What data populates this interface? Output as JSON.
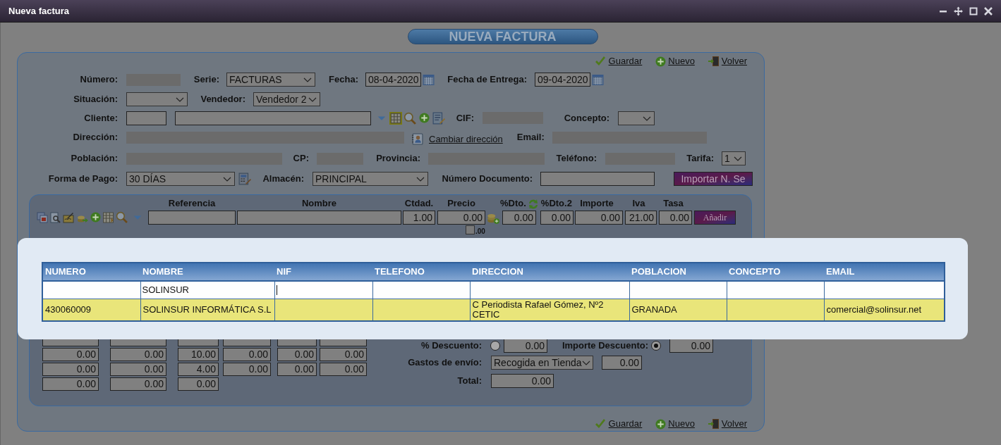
{
  "window": {
    "title": "Nueva factura"
  },
  "heading": "NUEVA FACTURA",
  "top_actions": [
    {
      "label": "Guardar"
    },
    {
      "label": "Nuevo"
    },
    {
      "label": "Volver"
    }
  ],
  "form": {
    "numero": {
      "label": "Número:"
    },
    "serie": {
      "label": "Serie:",
      "value": "FACTURAS"
    },
    "fecha": {
      "label": "Fecha:",
      "value": "08-04-2020"
    },
    "fecha_entrega": {
      "label": "Fecha de Entrega:",
      "value": "09-04-2020"
    },
    "situacion": {
      "label": "Situación:"
    },
    "vendedor": {
      "label": "Vendedor:",
      "value": "Vendedor 2"
    },
    "cliente": {
      "label": "Cliente:"
    },
    "cif": {
      "label": "CIF:"
    },
    "concepto": {
      "label": "Concepto:"
    },
    "direccion": {
      "label": "Dirección:"
    },
    "cambiar_direccion": "Cambiar dirección",
    "email": {
      "label": "Email:"
    },
    "poblacion": {
      "label": "Población:"
    },
    "cp": {
      "label": "CP:"
    },
    "provincia": {
      "label": "Provincia:"
    },
    "telefono": {
      "label": "Teléfono:"
    },
    "tarifa": {
      "label": "Tarifa:",
      "value": "1"
    },
    "forma_pago": {
      "label": "Forma de Pago:",
      "value": "30 DÍAS"
    },
    "almacen": {
      "label": "Almacén:",
      "value": "PRINCIPAL"
    },
    "numero_documento": {
      "label": "Número Documento:"
    },
    "import_button": "Importar N. Se"
  },
  "line_entry": {
    "columns": [
      "Referencia",
      "Nombre",
      "Ctdad.",
      "Precio",
      "%Dto.",
      "%Dto.2",
      "Importe",
      "Iva",
      "Tasa"
    ],
    "ctdad": "1.00",
    "precio": "0.00",
    "dto": "0.00",
    "dto2": "0.00",
    "importe": "0.00",
    "iva": "21.00",
    "tasa": "0.00",
    "decimals": {
      "label": ".00",
      "checked": false
    },
    "add_button": "Añadir"
  },
  "totals_grid": {
    "rows": [
      [
        "0.00",
        "0.00",
        "10.00",
        "0.00",
        "0.00",
        "0.00"
      ],
      [
        "0.00",
        "0.00",
        "4.00",
        "0.00",
        "0.00",
        "0.00"
      ],
      [
        "0.00",
        "0.00",
        "0.00"
      ]
    ]
  },
  "summary": {
    "descuento": {
      "label": "% Descuento:",
      "selected": false,
      "value": "0.00"
    },
    "importe_descuento": {
      "label": "Importe Descuento:",
      "selected": true,
      "value": "0.00"
    },
    "gastos_envio": {
      "label": "Gastos de envío:",
      "value": "Recogida en Tienda",
      "amount": "0.00"
    },
    "total": {
      "label": "Total:",
      "value": "0.00"
    }
  },
  "bottom_actions": [
    {
      "label": "Guardar"
    },
    {
      "label": "Nuevo"
    },
    {
      "label": "Volver"
    }
  ],
  "client_search": {
    "columns": [
      "NUMERO",
      "NOMBRE",
      "NIF",
      "TELEFONO",
      "DIRECCION",
      "POBLACION",
      "CONCEPTO",
      "EMAIL"
    ],
    "filters": [
      {
        "focused": false
      },
      {
        "value": "SOLINSUR",
        "focused": false
      },
      {
        "focused": true
      },
      {
        "focused": false
      },
      {
        "focused": false
      },
      {
        "focused": false
      },
      {
        "focused": false
      },
      {
        "focused": false
      }
    ],
    "rows": [
      {
        "selected": true,
        "cells": [
          {
            "text": "430060009"
          },
          {
            "text": "SOLINSUR INFORMÁTICA S.L"
          },
          {},
          {},
          {
            "text": "C Periodista Rafael Gómez, Nº2 CETIC"
          },
          {
            "text": "GRANADA"
          },
          {},
          {
            "text": "comercial@solinsur.net"
          }
        ]
      }
    ]
  }
}
